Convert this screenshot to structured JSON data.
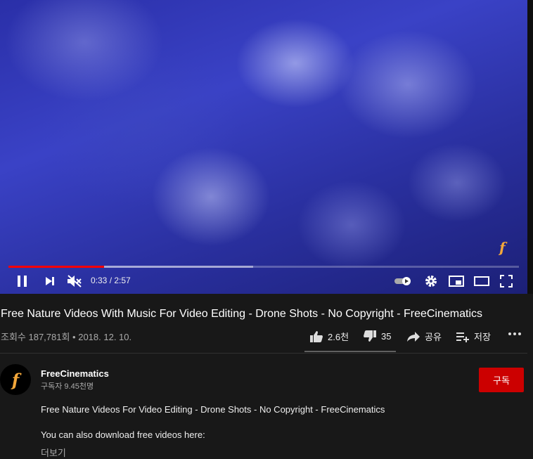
{
  "player": {
    "time_display": "0:33 / 2:57",
    "progress_fraction": 0.187,
    "buffered_fraction": 0.48,
    "watermark": "f"
  },
  "video": {
    "title": "Free Nature Videos With Music For Video Editing - Drone Shots - No Copyright - FreeCinematics",
    "views_date": "조회수 187,781회 • 2018. 12. 10."
  },
  "actions": {
    "like_count": "2.6천",
    "dislike_count": "35",
    "share_label": "공유",
    "save_label": "저장"
  },
  "channel": {
    "name": "FreeCinematics",
    "subscribers": "구독자 9.45천명",
    "subscribe_label": "구독",
    "avatar_letter": "f"
  },
  "description": {
    "line1": "Free Nature Videos For Video Editing - Drone Shots - No Copyright - FreeCinematics",
    "line2": "You can also download free videos here:",
    "more_label": "더보기"
  },
  "colors": {
    "accent": "#ff0000",
    "subscribe": "#cc0000",
    "background": "#181818"
  }
}
